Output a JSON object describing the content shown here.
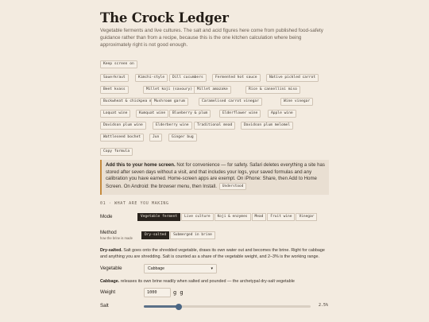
{
  "title": "The Crock Ledger",
  "intro": "Vegetable ferments and live cultures. The salt and acid figures here come from published food-safety guidance rather than from a recipe, because this is the one kitchen calculation where being approximately right is not good enough.",
  "keep_screen_on": "Keep screen on",
  "recipes": [
    "Sauerkraut",
    "Kimchi-style",
    "Dill cucumbers",
    "Fermented hot sauce",
    "Native pickled carrot",
    "Beet kvass",
    "Millet koji (savoury)",
    "Millet amazake",
    "Rice & cannellini miso",
    "Buckwheat & chickpea miso",
    "Mushroom garum",
    "Caramelised carrot vinegar",
    "Wine vinegar",
    "Loquat wine",
    "Kumquat wine",
    "Blueberry & plum",
    "Elderflower wine",
    "Apple wine",
    "Davidson plum wine",
    "Elderberry wine",
    "Traditional mead",
    "Davidson plum melomel",
    "Wattleseed bochet",
    "Jun",
    "Ginger bug"
  ],
  "copy_formula": "Copy formula",
  "notice": {
    "bold": "Add this to your home screen.",
    "text": " Not for convenience — for safety. Safari deletes everything a site has stored after seven days without a visit, and that includes your logs, your saved formulas and any calibration you have earned. Home-screen apps are exempt. On iPhone: Share, then Add to Home Screen. On Android: the browser menu, then Install.",
    "button": "Understood"
  },
  "section": "01 · WHAT ARE YOU MAKING",
  "mode": {
    "label": "Mode",
    "options": [
      "Vegetable ferment",
      "Live culture",
      "Koji & enzymes",
      "Mead",
      "Fruit wine",
      "Vinegar"
    ],
    "selected": 0
  },
  "method": {
    "label": "Method",
    "sublabel": "how the brine is made",
    "options": [
      "Dry-salted",
      "Submerged in brine"
    ],
    "selected": 0
  },
  "method_desc": {
    "bold": "Dry-salted.",
    "text": " Salt goes onto the shredded vegetable, draws its own water out and becomes the brine. Right for cabbage and anything you are shredding. Salt is counted as a share of the vegetable weight, and 2–3% is the working range."
  },
  "vegetable": {
    "label": "Vegetable",
    "value": "Cabbage"
  },
  "vegetable_desc": {
    "bold": "Cabbage.",
    "text": " releases its own brine readily when salted and pounded — the archetypal dry-salt vegetable"
  },
  "weight": {
    "label": "Weight",
    "value": "1000",
    "unit": "g g"
  },
  "salt": {
    "label": "Salt",
    "value": 2.5,
    "min": 0,
    "max": 5,
    "display": "2.5%"
  },
  "colors": {
    "accent": "#c58a3d",
    "slider": "#4a6684",
    "active": "#2a241e"
  }
}
